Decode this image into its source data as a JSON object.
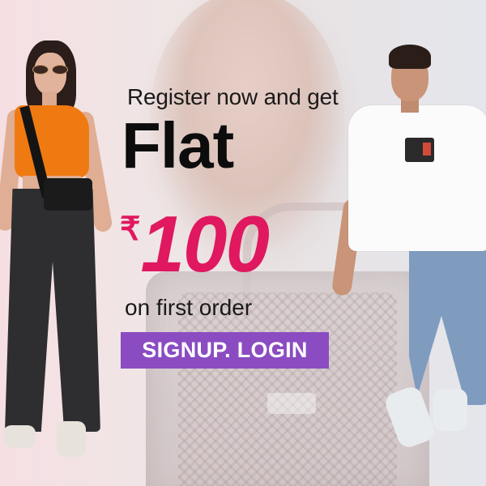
{
  "banner": {
    "headline_prefix": "Register now and get",
    "headline_main": "Flat",
    "currency_symbol": "₹",
    "amount": "100",
    "headline_suffix": "on first order",
    "cta_label": "SIGNUP. LOGIN"
  },
  "colors": {
    "amount": "#e0185f",
    "cta_background": "#8b4cc2",
    "cta_text": "#ffffff",
    "headline": "#0c0c0c"
  }
}
